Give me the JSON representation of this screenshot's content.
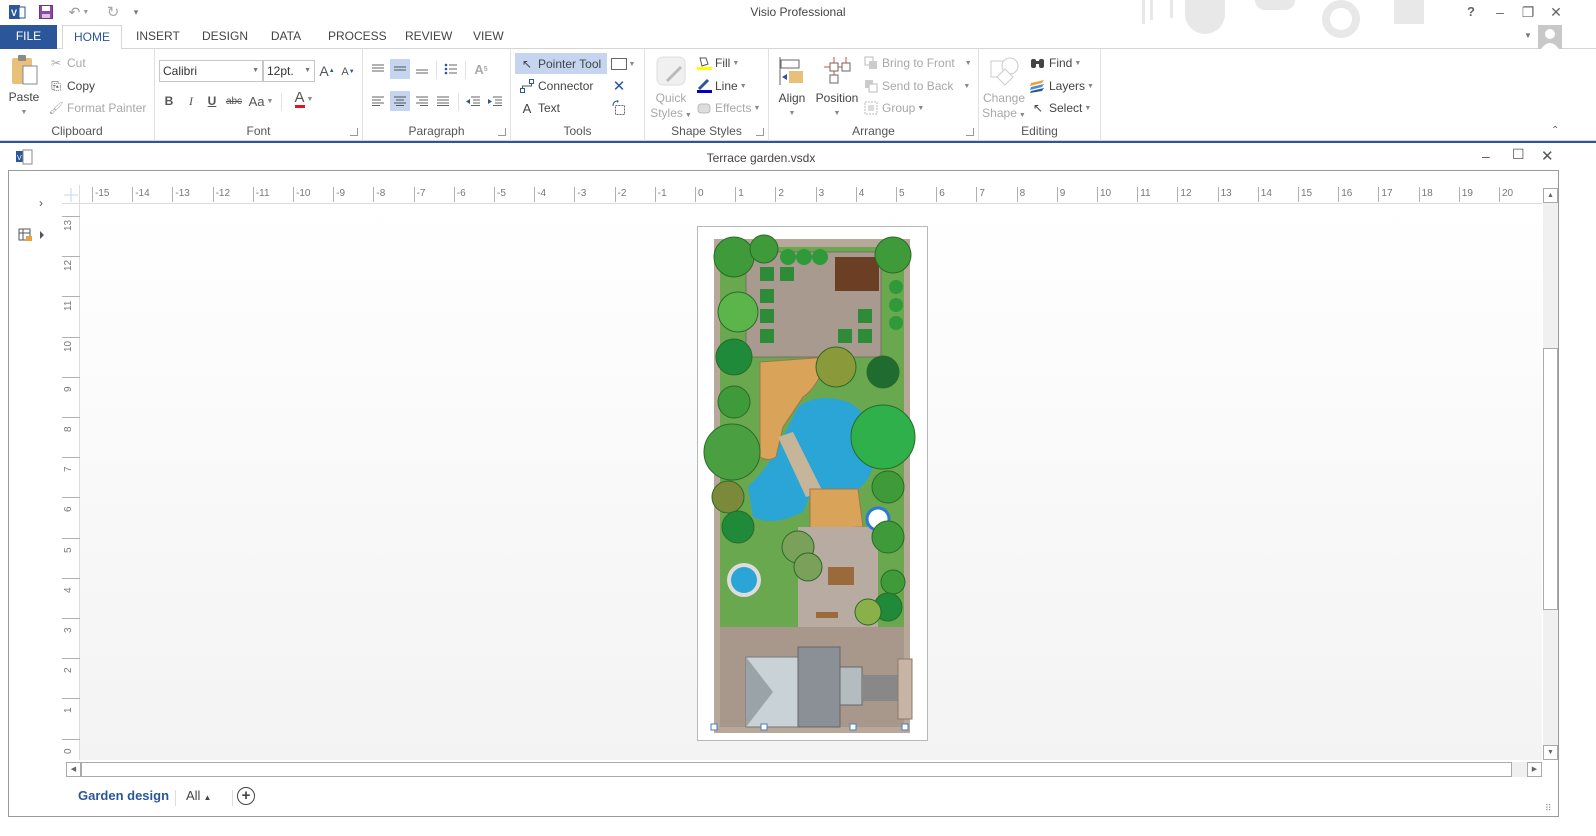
{
  "app": {
    "title": "Visio Professional",
    "window_controls": {
      "help": "?",
      "minimize": "–",
      "restore": "❐",
      "close": "✕"
    }
  },
  "quick_access": {
    "icons": [
      "visio-logo-icon",
      "save-icon",
      "undo-icon",
      "redo-icon",
      "customize-qat-icon"
    ]
  },
  "ribbon_tabs": [
    {
      "label": "FILE"
    },
    {
      "label": "HOME",
      "active": true
    },
    {
      "label": "INSERT"
    },
    {
      "label": "DESIGN"
    },
    {
      "label": "DATA"
    },
    {
      "label": "PROCESS"
    },
    {
      "label": "REVIEW"
    },
    {
      "label": "VIEW"
    }
  ],
  "ribbon": {
    "clipboard": {
      "label": "Clipboard",
      "paste": "Paste",
      "cut": "Cut",
      "copy": "Copy",
      "format_painter": "Format Painter"
    },
    "font": {
      "label": "Font",
      "font_name": "Calibri",
      "font_size": "12pt.",
      "bold": "B",
      "italic": "I",
      "underline": "U",
      "strikethrough": "abc",
      "change_case": "Aa",
      "grow": "A",
      "shrink": "A",
      "font_color_glyph": "A",
      "font_color": "#e81123"
    },
    "paragraph": {
      "label": "Paragraph"
    },
    "tools": {
      "label": "Tools",
      "pointer": "Pointer Tool",
      "connector": "Connector",
      "text": "Text"
    },
    "shape_styles": {
      "label": "Shape Styles",
      "quick_styles_1": "Quick",
      "quick_styles_2": "Styles",
      "fill": "Fill",
      "line": "Line",
      "effects": "Effects",
      "fill_color": "#ffff00",
      "line_color": "#0000cc"
    },
    "arrange": {
      "label": "Arrange",
      "align": "Align",
      "position": "Position",
      "bring_to_front": "Bring to Front",
      "send_to_back": "Send to Back",
      "group": "Group"
    },
    "editing": {
      "label": "Editing",
      "change_shape_1": "Change",
      "change_shape_2": "Shape",
      "find": "Find",
      "layers": "Layers",
      "select": "Select"
    }
  },
  "document": {
    "title": "Terrace garden.vsdx",
    "controls": {
      "minimize": "–",
      "maximize": "☐",
      "close": "✕"
    },
    "horizontal_ruler": [
      "-15",
      "-14",
      "-13",
      "-12",
      "-11",
      "-10",
      "-9",
      "-8",
      "-7",
      "-6",
      "-5",
      "-4",
      "-3",
      "-2",
      "-1",
      "0",
      "1",
      "2",
      "3",
      "4",
      "5",
      "6",
      "7",
      "8",
      "9",
      "10",
      "11",
      "12",
      "13",
      "14",
      "15",
      "16",
      "17",
      "18",
      "19",
      "20"
    ],
    "vertical_ruler": [
      "13",
      "12",
      "11",
      "10",
      "9",
      "8",
      "7",
      "6",
      "5",
      "4",
      "3",
      "2",
      "1",
      "0"
    ],
    "page_tabs": [
      {
        "label": "Garden design",
        "active": true
      },
      {
        "label": "All"
      }
    ],
    "add_page_glyph": "+"
  },
  "colors": {
    "accent": "#2b579a",
    "selection": "#c5d4ef",
    "paving": "#a89a8e",
    "lawn": "#5d9a3c",
    "water": "#2aa5d6",
    "stone": "#d9a35a",
    "roof_light": "#c9d2d6",
    "roof_dark": "#8a9095"
  }
}
